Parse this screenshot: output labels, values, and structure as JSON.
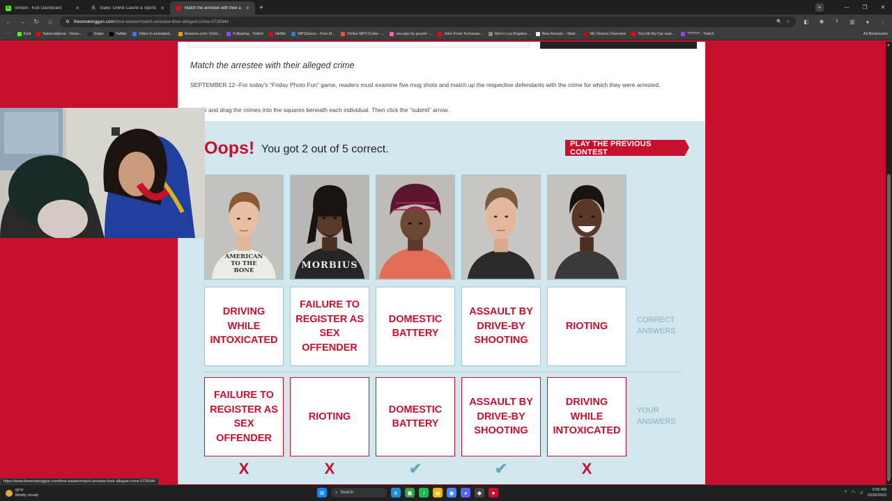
{
  "browser": {
    "tabs": [
      {
        "title": "Stream - Kick Dashboard",
        "icon": "K",
        "color": "#53fc18",
        "active": false
      },
      {
        "title": "Stake: Online Casino & Sports",
        "icon": "S",
        "color": "#1a2c38",
        "active": false
      },
      {
        "title": "Match the arrestee with their a",
        "icon": "■",
        "color": "#c8102e",
        "active": true
      }
    ],
    "url_host": "thesmokinggun.com",
    "url_path": "/time-waster/match-arrestee-their-alleged-crime-073594#",
    "bookmarks": [
      {
        "label": "Kick",
        "color": "#53fc18"
      },
      {
        "label": "Subscriptions - Youtu...",
        "color": "#ff0000"
      },
      {
        "label": "Stake",
        "color": "#1a2c38"
      },
      {
        "label": "Twitter",
        "color": "#000000"
      },
      {
        "label": "Video to animated...",
        "color": "#2e7df6"
      },
      {
        "label": "Amazon.com: Onlin...",
        "color": "#ff9900"
      },
      {
        "label": "Following - Twitch",
        "color": "#9146ff"
      },
      {
        "label": "Netflix",
        "color": "#e50914"
      },
      {
        "label": "MP3Juices - Free M...",
        "color": "#3b7bd4"
      },
      {
        "label": "Online MP3 Cutter -...",
        "color": "#e9553a"
      },
      {
        "label": "osu-pps by grumd -...",
        "color": "#ff66aa"
      },
      {
        "label": "John From Tennesse...",
        "color": "#e50914"
      },
      {
        "label": "Men's Los Angeles...",
        "color": "#888888"
      },
      {
        "label": "New Arrivals – Mad...",
        "color": "#eeeeee"
      },
      {
        "label": "My Verizon Overview",
        "color": "#cd040b"
      },
      {
        "label": "You Hit My Car reac...",
        "color": "#ff0000"
      },
      {
        "label": "?????? - Twitch",
        "color": "#9146ff"
      }
    ],
    "all_bookmarks": "All Bookmarks",
    "status_url": "https://www.thesmokinggun.com/time-waster/match-arrestee-their-alleged-crime-073594#"
  },
  "article": {
    "heading": "Match the arrestee with their alleged crime",
    "para1": "SEPTEMBER 12--For today's “Friday Photo Fun” game, readers must examine five mug shots and match up the respective defendants with the crime for which they were arrested.",
    "para2": "...click and drag the crimes into the squares beneath each individual. Then click the “submit” arrow."
  },
  "result": {
    "oops": "Oops!",
    "score_text": "You got 2 out of 5 correct.",
    "prev_button": "PLAY THE PREVIOUS CONTEST",
    "correct_label": "CORRECT ANSWERS",
    "your_label": "YOUR ANSWERS"
  },
  "mugshots": [
    {
      "shirt": "AMERICAN TO THE BONE"
    },
    {
      "shirt": "MORBIUS"
    },
    {
      "shirt": ""
    },
    {
      "shirt": ""
    },
    {
      "shirt": ""
    }
  ],
  "correct_answers": [
    "DRIVING WHILE INTOXICATED",
    "FAILURE TO REGISTER AS SEX OFFENDER",
    "DOMESTIC BATTERY",
    "ASSAULT BY DRIVE-BY SHOOTING",
    "RIOTING"
  ],
  "your_answers": [
    "FAILURE TO REGISTER AS SEX OFFENDER",
    "RIOTING",
    "DOMESTIC BATTERY",
    "ASSAULT BY DRIVE-BY SHOOTING",
    "DRIVING WHILE INTOXICATED"
  ],
  "marks": [
    "X",
    "X",
    "✔",
    "✔",
    "X"
  ],
  "marks_correct": [
    false,
    false,
    true,
    true,
    false
  ],
  "taskbar": {
    "temp": "55°F",
    "weather": "Mostly cloudy",
    "search": "Search",
    "time": "5:56 AM",
    "date": "10/26/2023"
  }
}
